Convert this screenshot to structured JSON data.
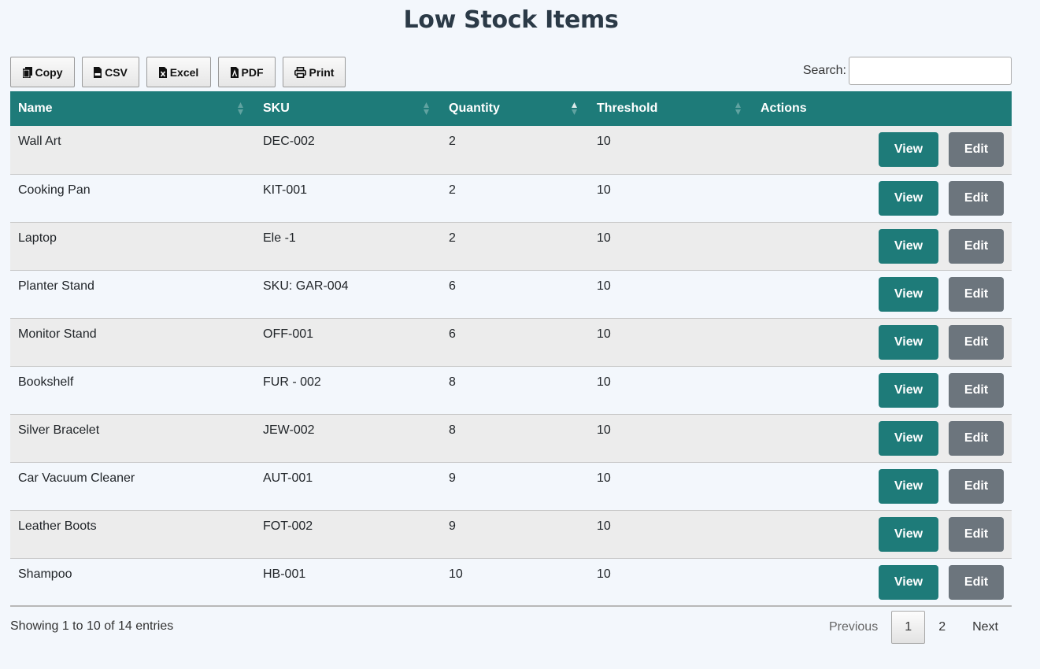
{
  "page": {
    "title": "Low Stock Items"
  },
  "toolbar": {
    "copy_label": "Copy",
    "csv_label": "CSV",
    "excel_label": "Excel",
    "pdf_label": "PDF",
    "print_label": "Print"
  },
  "search": {
    "label": "Search:",
    "value": "",
    "placeholder": ""
  },
  "table": {
    "columns": [
      "Name",
      "SKU",
      "Quantity",
      "Threshold",
      "Actions"
    ],
    "sorted_column": "Quantity",
    "sort_direction": "ascending",
    "view_label": "View",
    "edit_label": "Edit",
    "rows": [
      {
        "name": "Wall Art",
        "sku": "DEC-002",
        "quantity": "2",
        "threshold": "10"
      },
      {
        "name": "Cooking Pan",
        "sku": "KIT-001",
        "quantity": "2",
        "threshold": "10"
      },
      {
        "name": "Laptop",
        "sku": "Ele -1",
        "quantity": "2",
        "threshold": "10"
      },
      {
        "name": "Planter Stand",
        "sku": "SKU: GAR-004",
        "quantity": "6",
        "threshold": "10"
      },
      {
        "name": "Monitor Stand",
        "sku": "OFF-001",
        "quantity": "6",
        "threshold": "10"
      },
      {
        "name": "Bookshelf",
        "sku": "FUR - 002",
        "quantity": "8",
        "threshold": "10"
      },
      {
        "name": "Silver Bracelet",
        "sku": "JEW-002",
        "quantity": "8",
        "threshold": "10"
      },
      {
        "name": "Car Vacuum Cleaner",
        "sku": "AUT-001",
        "quantity": "9",
        "threshold": "10"
      },
      {
        "name": "Leather Boots",
        "sku": "FOT-002",
        "quantity": "9",
        "threshold": "10"
      },
      {
        "name": "Shampoo",
        "sku": "HB-001",
        "quantity": "10",
        "threshold": "10"
      }
    ]
  },
  "footer": {
    "info": "Showing 1 to 10 of 14 entries",
    "previous_label": "Previous",
    "pages": [
      "1",
      "2"
    ],
    "current_page": "1",
    "next_label": "Next"
  },
  "colors": {
    "header_bg": "#1e7b79",
    "view_button": "#1e7b79",
    "edit_button": "#6c757d",
    "page_bg": "#f3f7fc",
    "row_alt_bg": "#ececec"
  }
}
